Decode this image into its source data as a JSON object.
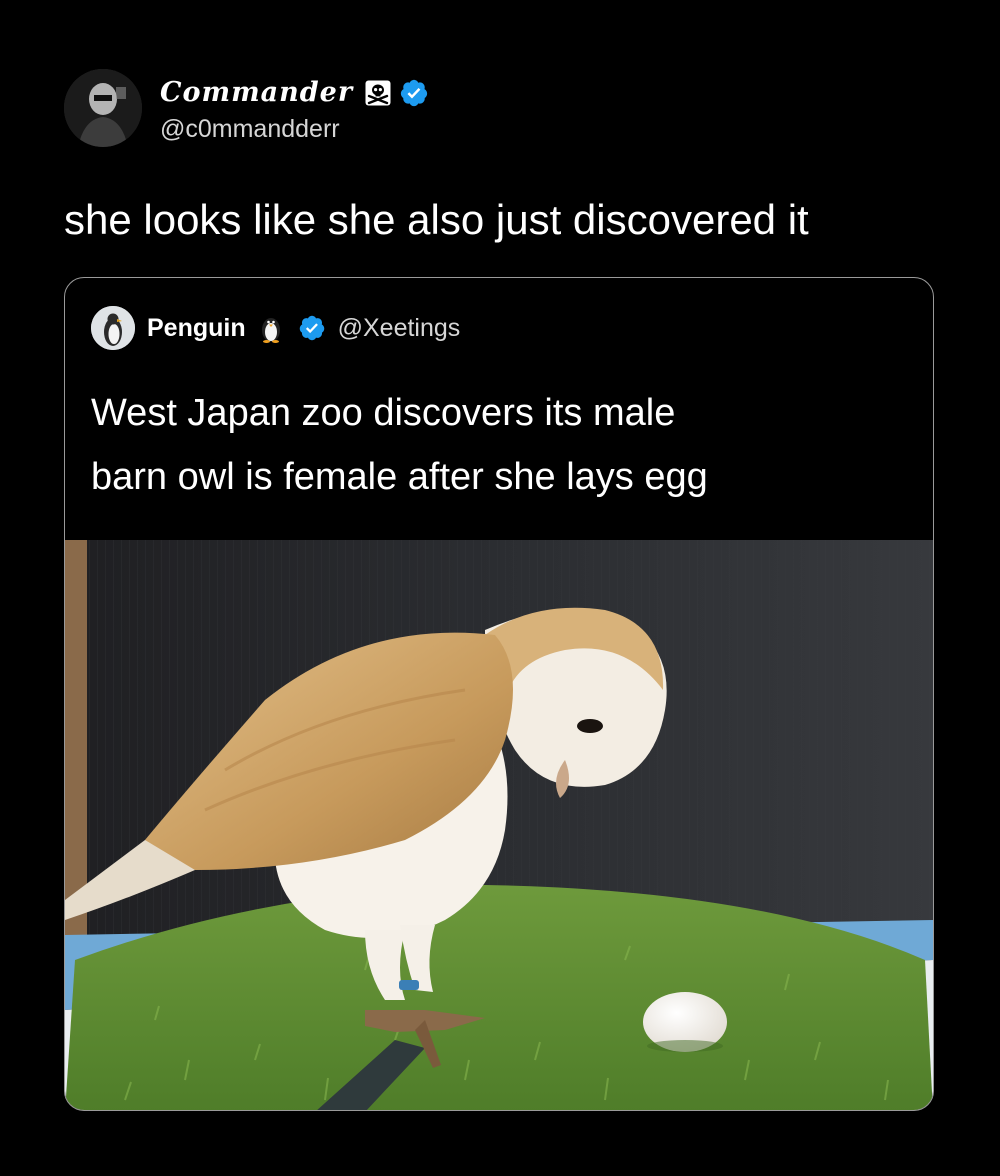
{
  "tweet": {
    "author": {
      "display_name": "Commander",
      "name_emoji": "skull-and-crossbones-icon",
      "verified": true,
      "handle": "@c0mmandderr"
    },
    "text": "she looks like she also just discovered it"
  },
  "quoted_tweet": {
    "author": {
      "display_name": "Penguin",
      "name_emoji": "penguin-icon",
      "verified": true,
      "handle": "@Xeetings"
    },
    "text_lines": [
      "West Japan zoo discovers its male",
      "barn owl is female after she lays egg"
    ],
    "image": {
      "subject": "barn owl looking at an egg on artificial grass"
    }
  },
  "colors": {
    "background": "#000000",
    "text_primary": "#ffffff",
    "text_secondary": "#d6d6d6",
    "verified_badge": "#1d9bf0",
    "card_border": "#9a9a9a"
  }
}
